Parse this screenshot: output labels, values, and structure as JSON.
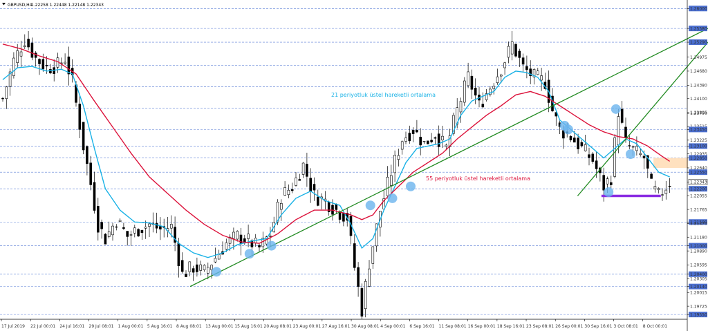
{
  "header": {
    "symbol": "GBPUSD,H4",
    "quote": "1.22258 1.22448 1.22148 1.22343"
  },
  "colors": {
    "ema21": "#1ab2e6",
    "ema55": "#dc143c",
    "trendline": "#228b22",
    "support": "#8a2be2",
    "zone": "#ffdcb4",
    "marker": "#6cb4ee",
    "label_bg": "#4a6ecf",
    "candle": "#000000"
  },
  "chart_data": {
    "type": "candlestick",
    "symbol": "GBPUSD",
    "timeframe": "H4",
    "ylim": [
      1.1945,
      1.2615
    ],
    "grid": true,
    "y_ticks": [
      1.26,
      1.2558,
      1.2529,
      1.24975,
      1.2468,
      1.2438,
      1.241,
      1.23805,
      1.2379,
      1.23515,
      1.2345,
      1.23225,
      1.231,
      1.22935,
      1.2285,
      1.2264,
      1.2255,
      1.22343,
      1.22055,
      1.222,
      1.21765,
      1.215,
      1.2147,
      1.2118,
      1.21,
      1.2089,
      1.20595,
      1.204,
      1.20305,
      1.2014,
      1.20015,
      1.19725,
      1.1955
    ],
    "y_highlight_levels": [
      1.26,
      1.2558,
      1.2529,
      1.248,
      1.2435,
      1.239,
      1.2345,
      1.231,
      1.2285,
      1.2255,
      1.222,
      1.215,
      1.21,
      1.204,
      1.2014,
      1.1955
    ],
    "current_price": 1.22343,
    "x_labels": [
      "17 Jul 2019",
      "22 Jul 00:01",
      "24 Jul 16:01",
      "29 Jul 08:01",
      "1 Aug 00:01",
      "5 Aug 16:01",
      "8 Aug 08:01",
      "13 Aug 00:01",
      "15 Aug 16:01",
      "20 Aug 08:01",
      "23 Aug 00:01",
      "27 Aug 16:01",
      "30 Aug 08:01",
      "4 Sep 00:01",
      "6 Sep 16:01",
      "11 Sep 08:01",
      "16 Sep 00:01",
      "18 Sep 16:01",
      "23 Sep 08:01",
      "26 Sep 00:01",
      "30 Sep 16:01",
      "3 Oct 08:01",
      "8 Oct 00:01"
    ],
    "price_path": [
      [
        0,
        1.241
      ],
      [
        3,
        1.249
      ],
      [
        6,
        1.2535
      ],
      [
        9,
        1.2495
      ],
      [
        12,
        1.2475
      ],
      [
        15,
        1.248
      ],
      [
        17,
        1.2495
      ],
      [
        19,
        1.2445
      ],
      [
        22,
        1.231
      ],
      [
        24,
        1.223
      ],
      [
        26,
        1.2145
      ],
      [
        28,
        1.2115
      ],
      [
        31,
        1.2155
      ],
      [
        34,
        1.212
      ],
      [
        37,
        1.2135
      ],
      [
        40,
        1.2145
      ],
      [
        43,
        1.2135
      ],
      [
        46,
        1.214
      ],
      [
        49,
        1.204
      ],
      [
        52,
        1.2055
      ],
      [
        55,
        1.2045
      ],
      [
        58,
        1.2075
      ],
      [
        61,
        1.2105
      ],
      [
        64,
        1.212
      ],
      [
        67,
        1.211
      ],
      [
        70,
        1.2095
      ],
      [
        73,
        1.2125
      ],
      [
        76,
        1.2205
      ],
      [
        79,
        1.2225
      ],
      [
        82,
        1.227
      ],
      [
        85,
        1.2205
      ],
      [
        88,
        1.2195
      ],
      [
        91,
        1.2175
      ],
      [
        94,
        1.216
      ],
      [
        96,
        1.2055
      ],
      [
        98,
        1.1965
      ],
      [
        100,
        1.2065
      ],
      [
        103,
        1.2175
      ],
      [
        106,
        1.2255
      ],
      [
        109,
        1.2325
      ],
      [
        112,
        1.2345
      ],
      [
        115,
        1.2315
      ],
      [
        118,
        1.2335
      ],
      [
        121,
        1.2305
      ],
      [
        124,
        1.2385
      ],
      [
        127,
        1.2455
      ],
      [
        130,
        1.2395
      ],
      [
        133,
        1.2435
      ],
      [
        136,
        1.2475
      ],
      [
        139,
        1.2525
      ],
      [
        142,
        1.2475
      ],
      [
        145,
        1.2455
      ],
      [
        148,
        1.2445
      ],
      [
        150,
        1.2385
      ],
      [
        152,
        1.2345
      ],
      [
        155,
        1.233
      ],
      [
        158,
        1.2305
      ],
      [
        161,
        1.228
      ],
      [
        164,
        1.2225
      ],
      [
        166,
        1.2245
      ],
      [
        168,
        1.2385
      ],
      [
        170,
        1.2315
      ],
      [
        173,
        1.2295
      ],
      [
        175,
        1.2285
      ],
      [
        177,
        1.2225
      ],
      [
        179,
        1.2205
      ],
      [
        181,
        1.2225
      ],
      [
        182,
        1.2234
      ]
    ],
    "series": [
      {
        "name": "21 periyotluk üstel hareketli ortalama",
        "values": [
          [
            0,
            1.245
          ],
          [
            4,
            1.2475
          ],
          [
            8,
            1.2478
          ],
          [
            12,
            1.2468
          ],
          [
            16,
            1.2472
          ],
          [
            19,
            1.2462
          ],
          [
            22,
            1.2395
          ],
          [
            25,
            1.2305
          ],
          [
            28,
            1.222
          ],
          [
            32,
            1.2175
          ],
          [
            36,
            1.215
          ],
          [
            40,
            1.2148
          ],
          [
            44,
            1.214
          ],
          [
            48,
            1.2105
          ],
          [
            52,
            1.2085
          ],
          [
            56,
            1.2075
          ],
          [
            60,
            1.2085
          ],
          [
            64,
            1.2102
          ],
          [
            68,
            1.211
          ],
          [
            72,
            1.2115
          ],
          [
            76,
            1.2165
          ],
          [
            80,
            1.22
          ],
          [
            84,
            1.2215
          ],
          [
            88,
            1.2195
          ],
          [
            92,
            1.2185
          ],
          [
            95,
            1.2145
          ],
          [
            98,
            1.2095
          ],
          [
            101,
            1.2115
          ],
          [
            104,
            1.2175
          ],
          [
            107,
            1.2225
          ],
          [
            110,
            1.2275
          ],
          [
            113,
            1.2305
          ],
          [
            116,
            1.231
          ],
          [
            119,
            1.2315
          ],
          [
            122,
            1.2325
          ],
          [
            125,
            1.2375
          ],
          [
            128,
            1.2405
          ],
          [
            131,
            1.2415
          ],
          [
            134,
            1.2425
          ],
          [
            137,
            1.2455
          ],
          [
            140,
            1.2468
          ],
          [
            143,
            1.2465
          ],
          [
            146,
            1.2455
          ],
          [
            149,
            1.2425
          ],
          [
            152,
            1.2365
          ],
          [
            155,
            1.2345
          ],
          [
            158,
            1.2325
          ],
          [
            161,
            1.2305
          ],
          [
            164,
            1.2285
          ],
          [
            167,
            1.2305
          ],
          [
            170,
            1.2325
          ],
          [
            173,
            1.2315
          ],
          [
            176,
            1.2285
          ],
          [
            179,
            1.2255
          ],
          [
            182,
            1.2245
          ]
        ]
      },
      {
        "name": "55 periyotluk üstel hareketli ortalama",
        "values": [
          [
            0,
            1.2525
          ],
          [
            5,
            1.2515
          ],
          [
            10,
            1.25
          ],
          [
            15,
            1.2488
          ],
          [
            20,
            1.2462
          ],
          [
            25,
            1.2405
          ],
          [
            30,
            1.235
          ],
          [
            35,
            1.2295
          ],
          [
            40,
            1.2245
          ],
          [
            45,
            1.221
          ],
          [
            50,
            1.2175
          ],
          [
            55,
            1.2145
          ],
          [
            60,
            1.2122
          ],
          [
            65,
            1.2108
          ],
          [
            70,
            1.2105
          ],
          [
            75,
            1.2125
          ],
          [
            80,
            1.2155
          ],
          [
            85,
            1.2175
          ],
          [
            90,
            1.2175
          ],
          [
            95,
            1.2165
          ],
          [
            98,
            1.2155
          ],
          [
            101,
            1.2165
          ],
          [
            104,
            1.2195
          ],
          [
            108,
            1.2225
          ],
          [
            112,
            1.2255
          ],
          [
            116,
            1.2275
          ],
          [
            120,
            1.2295
          ],
          [
            124,
            1.2325
          ],
          [
            128,
            1.235
          ],
          [
            132,
            1.2375
          ],
          [
            136,
            1.2395
          ],
          [
            140,
            1.2418
          ],
          [
            144,
            1.2425
          ],
          [
            148,
            1.2415
          ],
          [
            152,
            1.2395
          ],
          [
            156,
            1.2375
          ],
          [
            160,
            1.2355
          ],
          [
            164,
            1.234
          ],
          [
            168,
            1.233
          ],
          [
            172,
            1.2325
          ],
          [
            176,
            1.231
          ],
          [
            180,
            1.2288
          ],
          [
            182,
            1.2278
          ]
        ]
      }
    ],
    "trendlines": [
      {
        "from": [
          "8 Aug 08:01",
          1.2014
        ],
        "to": [
          "end of chart",
          1.2558
        ]
      },
      {
        "from": [
          "30 Sep 16:01",
          1.2205
        ],
        "to": [
          "end of chart",
          1.2529
        ]
      }
    ],
    "support_level": 1.2205,
    "resistance_zone": [
      1.2264,
      1.2285
    ]
  },
  "annotations": {
    "ema21_label": "21 periyotluk üstel hareketli ortalama",
    "ema55_label": "55 periyotluk üstel hareketli ortalama"
  }
}
